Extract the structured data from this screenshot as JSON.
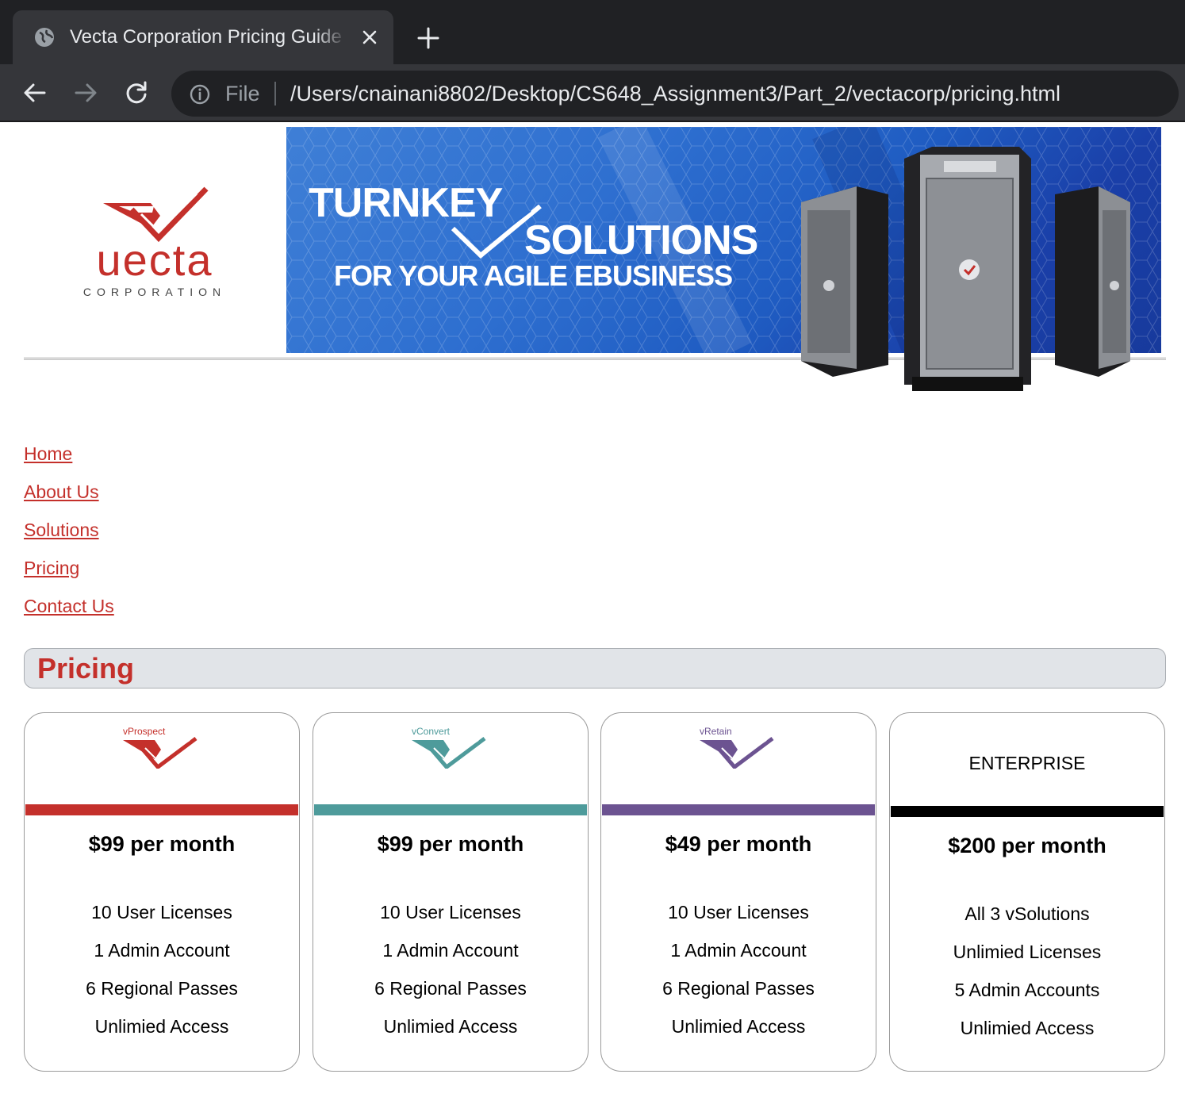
{
  "browser": {
    "tab_title": "Vecta Corporation Pricing Guide",
    "file_label": "File",
    "url": "/Users/cnainani8802/Desktop/CS648_Assignment3/Part_2/vectacorp/pricing.html",
    "icons": [
      "globe-icon",
      "close-icon",
      "plus-icon",
      "back-arrow-icon",
      "forward-arrow-icon",
      "reload-icon",
      "info-icon"
    ]
  },
  "header": {
    "logo_word": "uecta",
    "logo_sub": "CORPORATION",
    "banner_line1": "TURNKEY",
    "banner_line2": "SOLUTIONS",
    "banner_line3": "FOR YOUR AGILE EBUSINESS",
    "brand_color": "#c4302b"
  },
  "nav": {
    "items": [
      "Home",
      "About Us",
      "Solutions",
      "Pricing",
      "Contact Us"
    ]
  },
  "section": {
    "title": "Pricing"
  },
  "plans": [
    {
      "logo_label": "vProspect",
      "color": "#c4302b",
      "price": "$99 per month",
      "features": [
        "10 User Licenses",
        "1 Admin Account",
        "6 Regional Passes",
        "Unlimied Access"
      ]
    },
    {
      "logo_label": "vConvert",
      "color": "#4e9b9b",
      "price": "$99 per month",
      "features": [
        "10 User Licenses",
        "1 Admin Account",
        "6 Regional Passes",
        "Unlimied Access"
      ]
    },
    {
      "logo_label": "vRetain",
      "color": "#6c5391",
      "price": "$49 per month",
      "features": [
        "10 User Licenses",
        "1 Admin Account",
        "6 Regional Passes",
        "Unlimied Access"
      ]
    },
    {
      "label": "ENTERPRISE",
      "color": "#000000",
      "price": "$200 per month",
      "features": [
        "All 3 vSolutions",
        "Unlimied Licenses",
        "5 Admin Accounts",
        "Unlimied Access"
      ]
    }
  ]
}
